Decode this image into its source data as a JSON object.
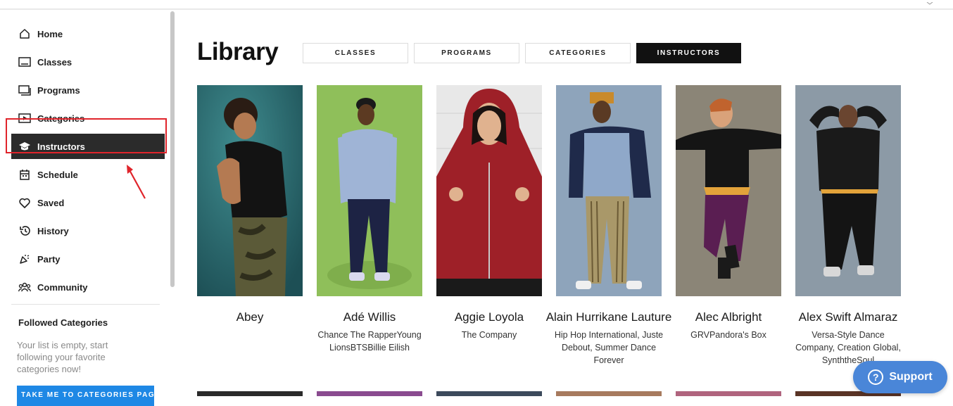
{
  "sidebar": {
    "items": [
      {
        "label": "Home",
        "icon": "home-icon"
      },
      {
        "label": "Classes",
        "icon": "classes-icon"
      },
      {
        "label": "Programs",
        "icon": "programs-icon"
      },
      {
        "label": "Categories",
        "icon": "categories-icon"
      },
      {
        "label": "Instructors",
        "icon": "graduation-cap-icon",
        "active": true
      },
      {
        "label": "Schedule",
        "icon": "calendar-icon"
      },
      {
        "label": "Saved",
        "icon": "heart-icon"
      },
      {
        "label": "History",
        "icon": "history-icon"
      },
      {
        "label": "Party",
        "icon": "party-icon"
      },
      {
        "label": "Community",
        "icon": "community-icon"
      }
    ],
    "followed": {
      "title": "Followed Categories",
      "empty_text": "Your list is empty, start following your favorite categories now!",
      "button_label": "TAKE ME TO CATEGORIES PAGE"
    }
  },
  "main": {
    "title": "Library",
    "tabs": [
      {
        "label": "CLASSES"
      },
      {
        "label": "PROGRAMS"
      },
      {
        "label": "CATEGORIES"
      },
      {
        "label": "INSTRUCTORS",
        "active": true
      }
    ],
    "instructors": [
      {
        "name": "Abey",
        "affiliation": ""
      },
      {
        "name": "Adé Willis",
        "affiliation": "Chance The RapperYoung LionsBTSBillie Eilish"
      },
      {
        "name": "Aggie Loyola",
        "affiliation": "The Company"
      },
      {
        "name": "Alain Hurrikane Lauture",
        "affiliation": "Hip Hop International, Juste Debout, Summer Dance Forever"
      },
      {
        "name": "Alec Albright",
        "affiliation": "GRVPandora's Box"
      },
      {
        "name": "Alex Swift Almaraz",
        "affiliation": "Versa-Style Dance Company, Creation Global, SynththeSoul"
      }
    ]
  },
  "support": {
    "label": "Support"
  },
  "colors": {
    "active_nav": "#2b2b2b",
    "highlight": "#e0242b",
    "support": "#4a86d8",
    "category_button": "#1e88e5"
  }
}
